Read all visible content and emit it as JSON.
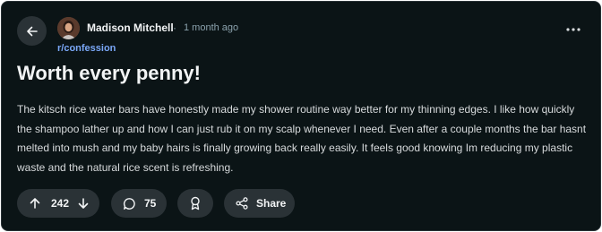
{
  "post": {
    "author": "Madison Mitchell",
    "separator": "·",
    "timestamp": "1 month ago",
    "subreddit": "r/confession",
    "title": "Worth every penny!",
    "body": "The kitsch rice water bars have honestly made my shower routine way better for my thinning edges. I like how quickly the shampoo lather up and how I can just rub it on my scalp whenever I need. Even after a couple months the bar hasnt melted into mush and my baby hairs is finally growing back really easily. It feels good knowing Im reducing my plastic waste and the natural rice scent is refreshing."
  },
  "actions": {
    "vote_count": "242",
    "comment_count": "75",
    "share_label": "Share"
  },
  "icons": {
    "back": "arrow-left-icon",
    "more": "more-horizontal-icon",
    "upvote": "arrow-up-icon",
    "downvote": "arrow-down-icon",
    "comment": "comment-bubble-icon",
    "award": "award-icon",
    "share": "share-icon"
  },
  "colors": {
    "background": "#0b1416",
    "pill": "#2a3236",
    "subreddit_link": "#7aa7f7",
    "muted_text": "#8ba2ad",
    "text": "#f2f4f5"
  }
}
